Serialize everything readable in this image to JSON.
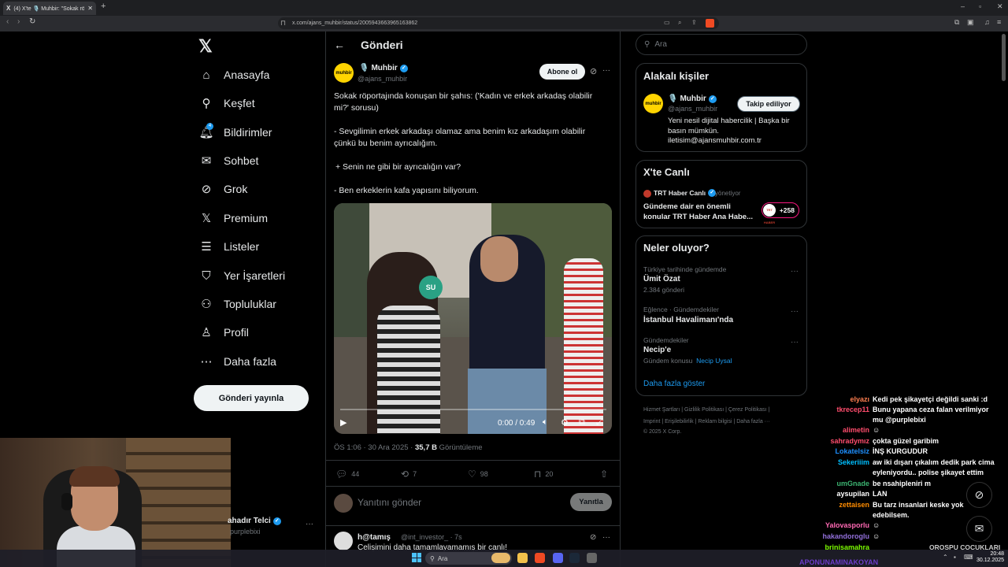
{
  "browser": {
    "tab_title": "(4) X'te 🎙️ Muhbir: \"Sokak röpo",
    "tab_favicon": "X",
    "url": "x.com/ajans_muhbir/status/2005943663965163862",
    "new_tab": "+"
  },
  "nav": {
    "items": [
      {
        "label": "Anasayfa",
        "icon": "home-icon"
      },
      {
        "label": "Keşfet",
        "icon": "search-icon"
      },
      {
        "label": "Bildirimler",
        "icon": "bell-icon"
      },
      {
        "label": "Sohbet",
        "icon": "mail-icon"
      },
      {
        "label": "Grok",
        "icon": "grok-icon"
      },
      {
        "label": "Premium",
        "icon": "x-icon"
      },
      {
        "label": "Listeler",
        "icon": "list-icon"
      },
      {
        "label": "Yer İşaretleri",
        "icon": "bookmark-icon"
      },
      {
        "label": "Topluluklar",
        "icon": "people-icon"
      },
      {
        "label": "Profil",
        "icon": "user-icon"
      },
      {
        "label": "Daha fazla",
        "icon": "more-circle-icon"
      }
    ],
    "notif_count": "4",
    "post_button": "Gönderi yayınla"
  },
  "post": {
    "page_title": "Gönderi",
    "author_name": "Muhbir",
    "author_emoji": "🎙️",
    "author_handle": "@ajans_muhbir",
    "avatar_text": "muhbir",
    "subscribe": "Abone ol",
    "lines": [
      "Sokak röportajında konuşan bir şahıs: ('Kadın ve erkek arkadaş olabilir",
      "mi?' sorusu)",
      "- Sevgilimin erkek arkadaşı olamaz ama benim kız arkadaşım olabilir",
      "çünkü bu benim ayrıcalığım.",
      "+ Senin ne gibi bir ayrıcalığın var?",
      "- Ben erkeklerin kafa yapısını biliyorum."
    ],
    "video_mic_text": "SU",
    "video_time": "0:00 / 0:49",
    "video_progress": 0,
    "meta_time": "ÖS 1:06 · 30 Ara 2025 · ",
    "views": "35,7 B",
    "views_label": " Görüntüleme",
    "replies": "44",
    "reposts": "7",
    "likes": "98",
    "bookmarks": "20",
    "reply_placeholder": "Yanıtını gönder",
    "reply_button": "Yanıtla"
  },
  "reply2": {
    "name": "h@tamış",
    "meta": "@int_investor_ · 7s",
    "text": "Çelişimini daha tamamlayamamış bir canlı!"
  },
  "right": {
    "search_placeholder": "Ara",
    "related_title": "Alakalı kişiler",
    "related_name": "Muhbir",
    "related_handle": "@ajans_muhbir",
    "related_follow": "Takip ediliyor",
    "related_bio": "Yeni nesil dijital habercilik | Başka bir basın mümkün. iletisim@ajansmuhbir.com.tr",
    "live_title": "X'te Canlı",
    "live_name": "TRT Haber Canlı",
    "live_role": "yönetiyor",
    "live_desc": "Gündeme dair en önemli konular TRT Haber Ana Habe...",
    "live_listeners": "+258",
    "live_avatar_text": "TRT HABER",
    "trends_title": "Neler oluyor?",
    "trends": [
      {
        "ctx": "Türkiye tarihinde gündemde",
        "name": "Ümit Özat",
        "count": "2.384 gönderi"
      },
      {
        "ctx": "Eğlence · Gündemdekiler",
        "name": "İstanbul Havalimanı'nda",
        "count": ""
      },
      {
        "ctx": "Gündemdekiler",
        "name": "Necip'e",
        "count": "Gündem konusu",
        "topic": "Necip Uysal"
      }
    ],
    "show_more": "Daha fazla göster",
    "footer": [
      "Hizmet Şartları  |  Gizlilik Politikası  |  Çerez Politikası  |",
      "Imprint  |  Erişilebilirlik  |  Reklam bilgisi  |  Daha fazla ···",
      "© 2025 X Corp."
    ]
  },
  "account": {
    "name": "ahadır Telci",
    "handle": "purplebixi"
  },
  "chat": [
    {
      "user": "elyazı",
      "color": "#ff7f50",
      "text": "Kedi pek şikayetçi değildi sanki :d"
    },
    {
      "user": "tkrecep11",
      "color": "#ff4d6d",
      "text": "Bunu yapana ceza falan verilmiyor"
    },
    {
      "user": "",
      "color": "#ffffff",
      "text": "mu @purplebixi"
    },
    {
      "user": "alimetin",
      "color": "#ff4d6d",
      "text": "☺"
    },
    {
      "user": "sahradymız",
      "color": "#ff4d6d",
      "text": "çokta güzel garibim"
    },
    {
      "user": "Lokatelsiz",
      "color": "#1e90ff",
      "text": "İNŞ KURGUDUR"
    },
    {
      "user": "Sekeriiim",
      "color": "#00bfff",
      "text": "aw iki dışarı çıkalım dedik park cima"
    },
    {
      "user": "",
      "color": "#ffffff",
      "text": "eyleniyordu.. polise şikayet ettim"
    },
    {
      "user": "umGnade",
      "color": "#3cb371",
      "text": "be nsahipleniri m"
    },
    {
      "user": "aysupilan",
      "color": "#ffffff",
      "text": "LAN"
    },
    {
      "user": "zettaisen",
      "color": "#ff8c00",
      "text": "Bu tarz insanlari keske yok"
    },
    {
      "user": "",
      "color": "#ffffff",
      "text": "edebilsem."
    },
    {
      "user": "Yalovasporlu",
      "color": "#ff69b4",
      "text": "☺"
    },
    {
      "user": "hakandoroglu",
      "color": "#9370db",
      "text": "☺"
    },
    {
      "user": "brinisamahra",
      "color": "#7cfc00",
      "text": ""
    }
  ],
  "ticker": "APONUNAMINAKOYAN",
  "corner_text": "OROSPU ÇOCUKLARI",
  "taskbar": {
    "search": "Ara",
    "time": "20:48",
    "date": "30.12.2025"
  },
  "colors": {
    "accent": "#1d9bf0",
    "background": "#000000",
    "muhbir_brand": "#ffd400",
    "live_ring": "#f91880"
  }
}
